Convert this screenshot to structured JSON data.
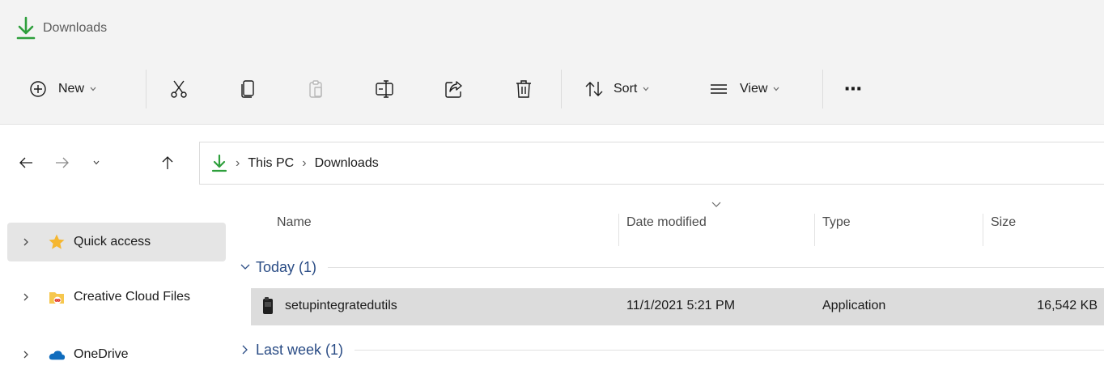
{
  "window": {
    "title": "Downloads",
    "accent_color": "#2e9f3c"
  },
  "toolbar": {
    "new_label": "New",
    "sort_label": "Sort",
    "view_label": "View",
    "more_label": "⋯",
    "icons": [
      "plus-circle-icon",
      "cut-icon",
      "copy-icon",
      "paste-icon",
      "rename-icon",
      "share-icon",
      "delete-icon",
      "sort-icon",
      "view-icon",
      "more-icon"
    ]
  },
  "address": {
    "separator": "›",
    "crumbs": [
      "This PC",
      "Downloads"
    ]
  },
  "sidebar": {
    "items": [
      {
        "label": "Quick access",
        "icon": "star-icon",
        "selected": true
      },
      {
        "label": "Creative Cloud Files",
        "icon": "creative-cloud-icon",
        "selected": false
      },
      {
        "label": "OneDrive",
        "icon": "onedrive-cloud-icon",
        "selected": false
      }
    ]
  },
  "columns": {
    "name": "Name",
    "date": "Date modified",
    "type": "Type",
    "size": "Size"
  },
  "groups": [
    {
      "label": "Today (1)",
      "expanded": true
    },
    {
      "label": "Last week (1)",
      "expanded": false
    }
  ],
  "files": [
    {
      "name": "setupintegratedutils",
      "date": "11/1/2021 5:21 PM",
      "type": "Application",
      "size": "16,542 KB",
      "selected": true
    }
  ]
}
